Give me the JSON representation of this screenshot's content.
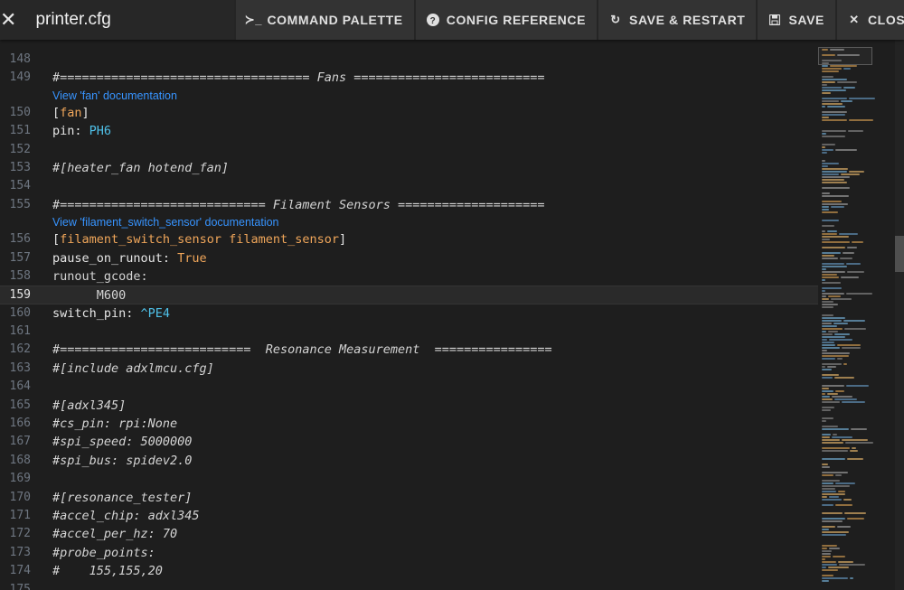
{
  "toolbar": {
    "close_icon": "✕",
    "title": "printer.cfg",
    "buttons": [
      {
        "icon": "≻_",
        "label": "COMMAND PALETTE"
      },
      {
        "icon": "?",
        "label": "CONFIG REFERENCE"
      },
      {
        "icon": "↻",
        "label": "SAVE & RESTART"
      },
      {
        "icon": "💾",
        "label": "SAVE"
      },
      {
        "icon": "✕",
        "label": "CLOSE"
      }
    ]
  },
  "editor": {
    "links": {
      "fan": "View 'fan' documentation",
      "filament": "View 'filament_switch_sensor' documentation"
    },
    "lines": [
      {
        "num": "148",
        "text": ""
      },
      {
        "num": "149",
        "text": "#================================== Fans =========================="
      },
      {
        "num": "150",
        "text": "[fan]"
      },
      {
        "num": "151",
        "text": "pin: PH6"
      },
      {
        "num": "152",
        "text": ""
      },
      {
        "num": "153",
        "text": "#[heater_fan hotend_fan]"
      },
      {
        "num": "154",
        "text": ""
      },
      {
        "num": "155",
        "text": "#============================ Filament Sensors ===================="
      },
      {
        "num": "156",
        "text": "[filament_switch_sensor filament_sensor]"
      },
      {
        "num": "157",
        "text": "pause_on_runout: True"
      },
      {
        "num": "158",
        "text": "runout_gcode:"
      },
      {
        "num": "159",
        "text": "      M600"
      },
      {
        "num": "160",
        "text": "switch_pin: ^PE4"
      },
      {
        "num": "161",
        "text": ""
      },
      {
        "num": "162",
        "text": "#==========================  Resonance Measurement  ================"
      },
      {
        "num": "163",
        "text": "#[include adxlmcu.cfg]"
      },
      {
        "num": "164",
        "text": ""
      },
      {
        "num": "165",
        "text": "#[adxl345]"
      },
      {
        "num": "166",
        "text": "#cs_pin: rpi:None"
      },
      {
        "num": "167",
        "text": "#spi_speed: 5000000"
      },
      {
        "num": "168",
        "text": "#spi_bus: spidev2.0"
      },
      {
        "num": "169",
        "text": ""
      },
      {
        "num": "170",
        "text": "#[resonance_tester]"
      },
      {
        "num": "171",
        "text": "#accel_chip: adxl345"
      },
      {
        "num": "172",
        "text": "#accel_per_hz: 70"
      },
      {
        "num": "173",
        "text": "#probe_points:"
      },
      {
        "num": "174",
        "text": "#    155,155,20"
      },
      {
        "num": "175",
        "text": ""
      }
    ]
  },
  "colors": {
    "comment": "#8a8a8a",
    "section": "#f0a65a",
    "value": "#4fc1e9",
    "link": "#3794ff"
  }
}
